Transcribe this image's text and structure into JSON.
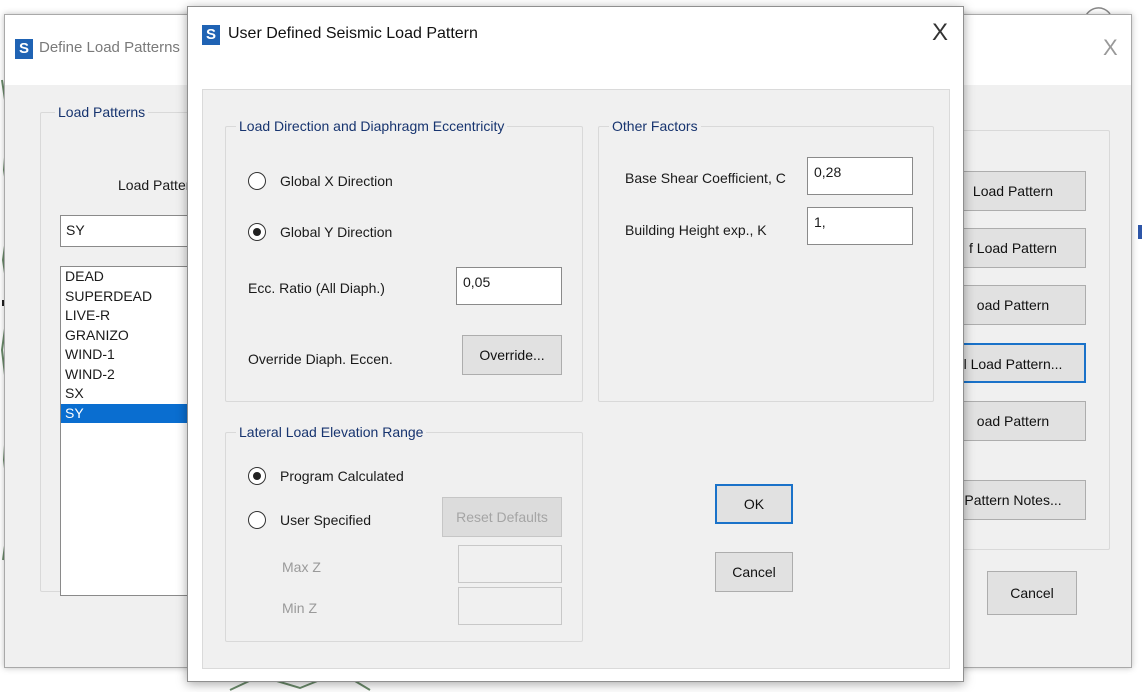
{
  "back_dialog": {
    "title": "Define Load Patterns",
    "close_glyph": "X",
    "group_title": "Load Patterns",
    "column_label": "Load Pattern Name",
    "name_value": "SY",
    "list": [
      "DEAD",
      "SUPERDEAD",
      "LIVE-R",
      "GRANIZO",
      "WIND-1",
      "WIND-2",
      "SX",
      "SY"
    ],
    "selected_index": 7,
    "buttons": [
      "Add New Load Pattern",
      "Modify Load Pattern",
      "Modify Load Pattern",
      "Modify Lateral Load Pattern...",
      "Delete Load Pattern",
      "Show Load Pattern Notes..."
    ],
    "button_visible_text": [
      "Load Pattern",
      "f Load Pattern",
      "oad Pattern",
      "l Load Pattern...",
      "oad Pattern",
      "Pattern Notes..."
    ],
    "cancel": "Cancel"
  },
  "dialog": {
    "logo": "S",
    "title": "User Defined Seismic Load Pattern",
    "close_glyph": "X",
    "direction_group": {
      "title": "Load Direction and Diaphragm Eccentricity",
      "options": [
        "Global  X  Direction",
        "Global  Y  Direction"
      ],
      "selected": 1,
      "ecc_label": "Ecc. Ratio (All Diaph.)",
      "ecc_value": "0,05",
      "override_label": "Override Diaph. Eccen.",
      "override_button": "Override..."
    },
    "factors_group": {
      "title": "Other Factors",
      "base_shear_label": "Base Shear Coefficient, C",
      "base_shear_value": "0,28",
      "height_exp_label": "Building Height exp., K",
      "height_exp_value": "1,"
    },
    "elevation_group": {
      "title": "Lateral Load Elevation Range",
      "options": [
        "Program Calculated",
        "User Specified"
      ],
      "selected": 0,
      "reset_button": "Reset Defaults",
      "max_z_label": "Max Z",
      "min_z_label": "Min Z",
      "max_z_value": "",
      "min_z_value": ""
    },
    "ok": "OK",
    "cancel": "Cancel"
  },
  "colors": {
    "accent": "#1a72c9",
    "selection": "#0a6ed0",
    "group_title": "#17346f",
    "logo": "#1f63b4"
  }
}
